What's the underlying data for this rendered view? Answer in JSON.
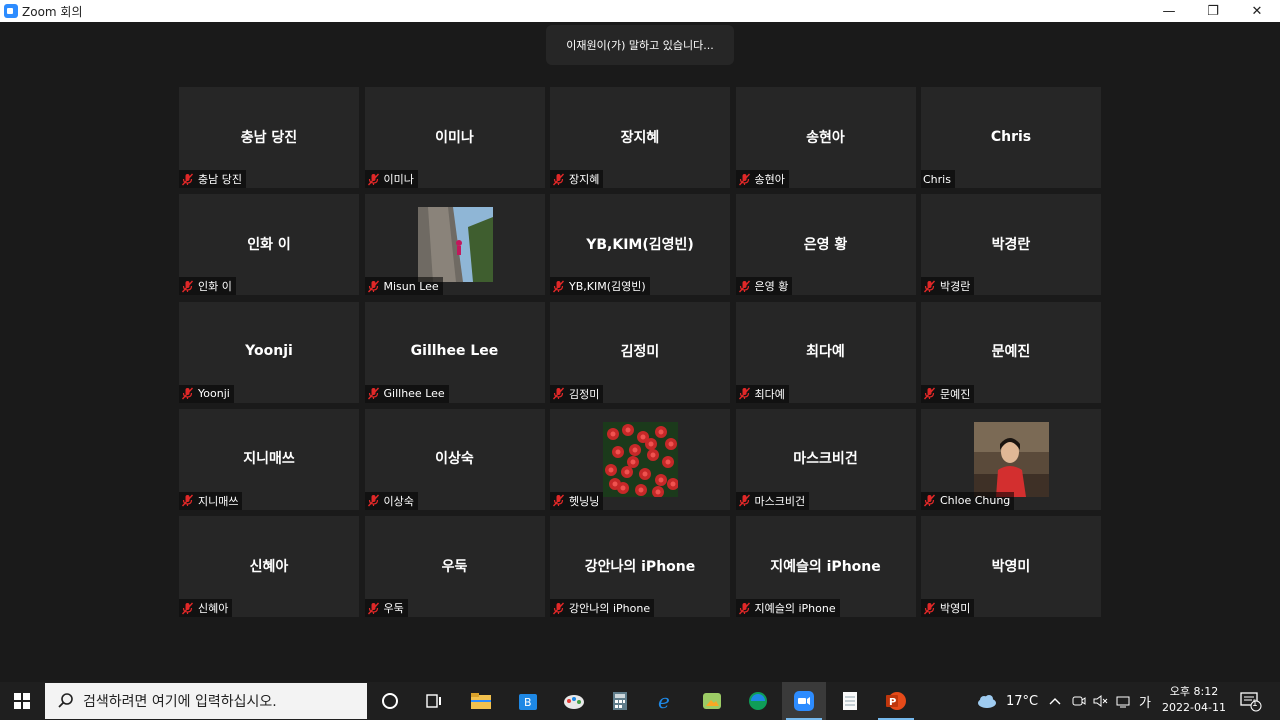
{
  "window": {
    "title": "Zoom 회의",
    "minimize": "—",
    "maximize": "❐",
    "close": "✕"
  },
  "speaking_banner": "이재원이(가) 말하고 있습니다...",
  "participants": [
    {
      "display": "충남 당진",
      "label": "충남 당진",
      "muted": true
    },
    {
      "display": "이미나",
      "label": "이미나",
      "muted": true
    },
    {
      "display": "장지혜",
      "label": "장지혜",
      "muted": true
    },
    {
      "display": "송현아",
      "label": "송현아",
      "muted": true
    },
    {
      "display": "Chris",
      "label": "Chris",
      "muted": false
    },
    {
      "display": "인화 이",
      "label": "인화 이",
      "muted": true
    },
    {
      "display": "",
      "label": "Misun Lee",
      "muted": true,
      "photo": "rock-climber"
    },
    {
      "display": "YB,KIM(김영빈)",
      "label": "YB,KIM(김영빈)",
      "muted": true
    },
    {
      "display": "은영 황",
      "label": "은영 황",
      "muted": true
    },
    {
      "display": "박경란",
      "label": "박경란",
      "muted": true
    },
    {
      "display": "Yoonji",
      "label": "Yoonji",
      "muted": true
    },
    {
      "display": "Gillhee Lee",
      "label": "Gillhee Lee",
      "muted": true
    },
    {
      "display": "김정미",
      "label": "김정미",
      "muted": true
    },
    {
      "display": "최다예",
      "label": "최다예",
      "muted": true
    },
    {
      "display": "문예진",
      "label": "문예진",
      "muted": true
    },
    {
      "display": "지니매쓰",
      "label": "지니매쓰",
      "muted": true
    },
    {
      "display": "이상숙",
      "label": "이상숙",
      "muted": true
    },
    {
      "display": "",
      "label": "헷닝닝",
      "muted": true,
      "photo": "red-flowers"
    },
    {
      "display": "마스크비건",
      "label": "마스크비건",
      "muted": true
    },
    {
      "display": "",
      "label": "Chloe Chung",
      "muted": true,
      "photo": "woman-red"
    },
    {
      "display": "신혜아",
      "label": "신혜아",
      "muted": true
    },
    {
      "display": "우둑",
      "label": "우둑",
      "muted": true
    },
    {
      "display": "강안나의 iPhone",
      "label": "강안나의 iPhone",
      "muted": true
    },
    {
      "display": "지예슬의 iPhone",
      "label": "지예슬의 iPhone",
      "muted": true
    },
    {
      "display": "박영미",
      "label": "박영미",
      "muted": true
    }
  ],
  "taskbar": {
    "search_placeholder": "검색하려면 여기에 입력하십시오.",
    "apps": [
      "cortana-icon",
      "task-view-icon",
      "file-explorer-icon",
      "store-icon",
      "paint-icon",
      "calculator-icon",
      "ie-icon",
      "photo-icon",
      "edge-icon",
      "zoom-icon",
      "notepad-icon",
      "powerpoint-icon"
    ],
    "weather": "17°C",
    "ime": "가",
    "clock_time": "오후 8:12",
    "clock_date": "2022-04-11",
    "notification_count": "1"
  },
  "colors": {
    "tile_bg": "#262626",
    "stage_bg": "#1a1a1a",
    "muted_red": "#e02828",
    "zoom_blue": "#2d8cff"
  }
}
